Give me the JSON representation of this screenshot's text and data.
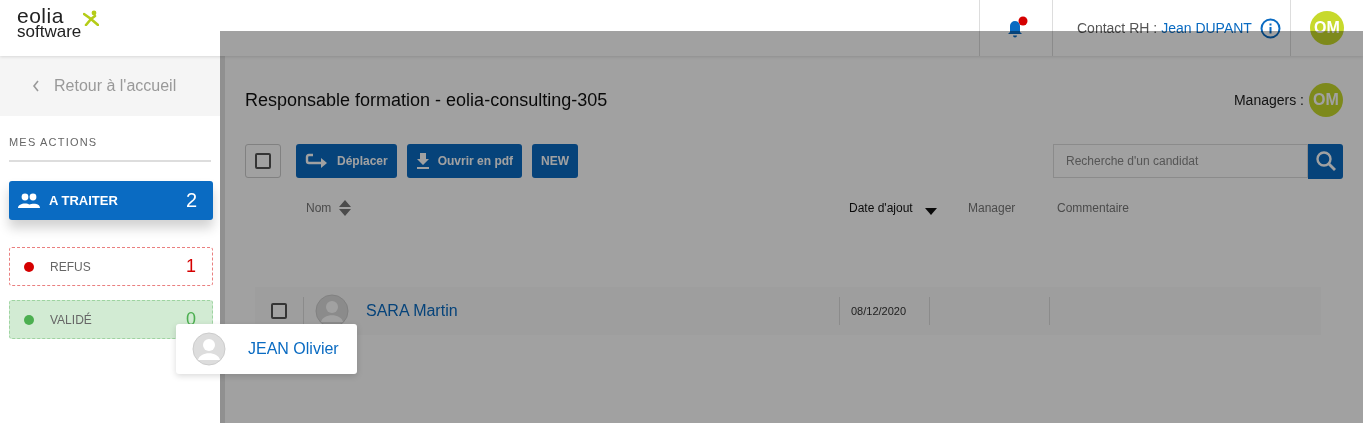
{
  "header": {
    "logo": [
      "eolia",
      "software"
    ],
    "notifications": {
      "unread": true
    },
    "contact_label": "Contact RH :",
    "contact_name": "Jean DUPANT",
    "user_initials": "OM"
  },
  "sidebar": {
    "back_link": "Retour à l'accueil",
    "section_title": "MES ACTIONS",
    "items": [
      {
        "kind": "group",
        "label": "A TRAITER",
        "count": "2",
        "selected": true,
        "color": "#0a6bc2"
      },
      {
        "kind": "status",
        "label": "REFUS",
        "count": "1",
        "selected": false,
        "color": "#d50000"
      },
      {
        "kind": "status",
        "label": "VALIDÉ",
        "count": "0",
        "selected": false,
        "color": "#4caf50"
      }
    ]
  },
  "main": {
    "title": "Responsable formation - eolia-consulting-305",
    "managers_label": "Managers :",
    "managers": [
      "OM"
    ],
    "select_all": {
      "checked": false
    },
    "buttons": [
      {
        "kind": "move",
        "label": "Déplacer"
      },
      {
        "kind": "download",
        "label": "Ouvrir en pdf"
      },
      {
        "kind": "plain",
        "label": "NEW"
      }
    ],
    "search": {
      "placeholder": "Recherche d'un candidat"
    },
    "columns": [
      {
        "label": "Nom",
        "kind": "sortable",
        "active": false
      },
      {
        "label": "Date d'ajout",
        "kind": "sorted",
        "active": true
      },
      {
        "label": "Manager",
        "kind": "plain",
        "active": false
      },
      {
        "label": "Commentaire",
        "kind": "plain",
        "active": false
      }
    ],
    "rows": [
      {
        "name": "SARA Martin",
        "date": "08/12/2020",
        "checked": false
      }
    ]
  },
  "drag": {
    "active": true,
    "card": {
      "name": "JEAN Olivier"
    }
  }
}
